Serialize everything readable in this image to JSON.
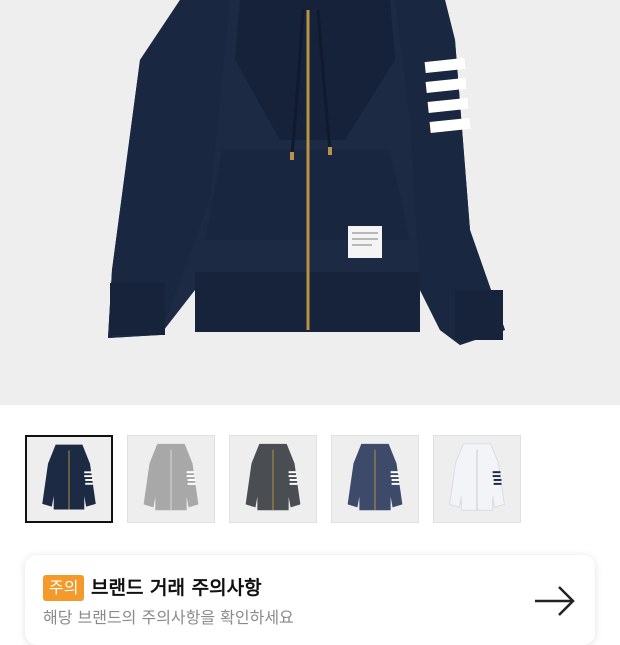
{
  "product": {
    "main_image": "navy-zip-hoodie",
    "main_color": "#1c2a44",
    "thumbnails": [
      {
        "name": "navy-hoodie",
        "color": "#1c2a44",
        "stripe": "#ffffff",
        "selected": true
      },
      {
        "name": "grey-hoodie",
        "color": "#a8a8a8",
        "stripe": "#ffffff",
        "selected": false
      },
      {
        "name": "charcoal-hoodie",
        "color": "#4a4d52",
        "stripe": "#ffffff",
        "selected": false
      },
      {
        "name": "blue-grey-hoodie",
        "color": "#3e4a6a",
        "stripe": "#ffffff",
        "selected": false
      },
      {
        "name": "white-hoodie",
        "color": "#f3f4f7",
        "stripe": "#1c2a44",
        "selected": false
      }
    ]
  },
  "notice": {
    "badge": "주의",
    "title": "브랜드 거래 주의사항",
    "subtitle": "해당 브랜드의 주의사항을 확인하세요",
    "arrow_icon": "arrow-right-icon",
    "accent": "#f39a2b"
  }
}
